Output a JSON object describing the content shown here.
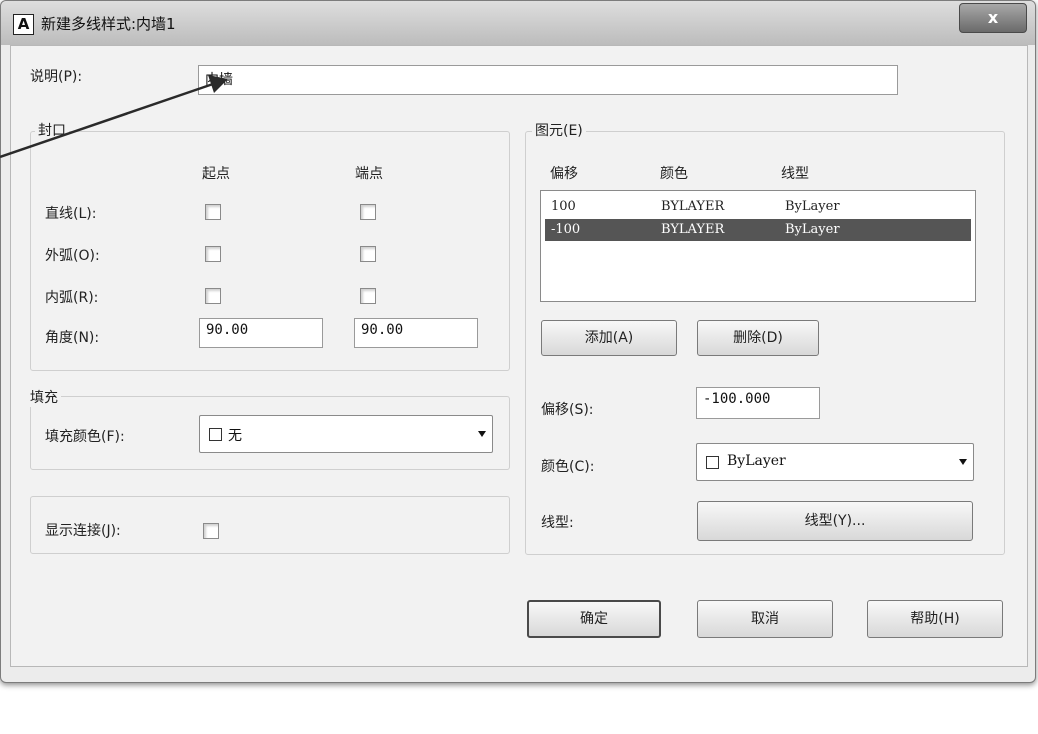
{
  "dialog": {
    "title": "新建多线样式:内墙1",
    "icon_label": "A",
    "close_label": "x"
  },
  "description": {
    "label": "说明(P):",
    "value": "内墙"
  },
  "caps": {
    "title": "封口",
    "col_start": "起点",
    "col_end": "端点",
    "rows": [
      {
        "label": "直线(L):",
        "start_checked": false,
        "end_checked": false
      },
      {
        "label": "外弧(O):",
        "start_checked": false,
        "end_checked": false
      },
      {
        "label": "内弧(R):",
        "start_checked": false,
        "end_checked": false
      }
    ],
    "angle": {
      "label": "角度(N):",
      "start": "90.00",
      "end": "90.00"
    }
  },
  "fill": {
    "title": "填充",
    "label": "填充颜色(F):",
    "value": "无"
  },
  "joints": {
    "label": "显示连接(J):",
    "checked": false
  },
  "elements": {
    "title": "图元(E)",
    "headers": {
      "offset": "偏移",
      "color": "颜色",
      "linetype": "线型"
    },
    "rows": [
      {
        "offset": "100",
        "color": "BYLAYER",
        "linetype": "ByLayer",
        "selected": false
      },
      {
        "offset": "-100",
        "color": "BYLAYER",
        "linetype": "ByLayer",
        "selected": true
      }
    ],
    "add_label": "添加(A)",
    "delete_label": "删除(D)",
    "offset_label": "偏移(S):",
    "offset_value": "-100.000",
    "color_label": "颜色(C):",
    "color_value": "ByLayer",
    "linetype_label": "线型:",
    "linetype_button": "线型(Y)..."
  },
  "footer": {
    "ok": "确定",
    "cancel": "取消",
    "help": "帮助(H)"
  },
  "colors": {
    "selected_row": "#555555",
    "dialog_bg": "#f2f2f2"
  },
  "icons": [
    "app-logo-icon",
    "close-icon",
    "color-swatch-icon",
    "dropdown-arrow-icon",
    "annotation-arrow-icon"
  ]
}
